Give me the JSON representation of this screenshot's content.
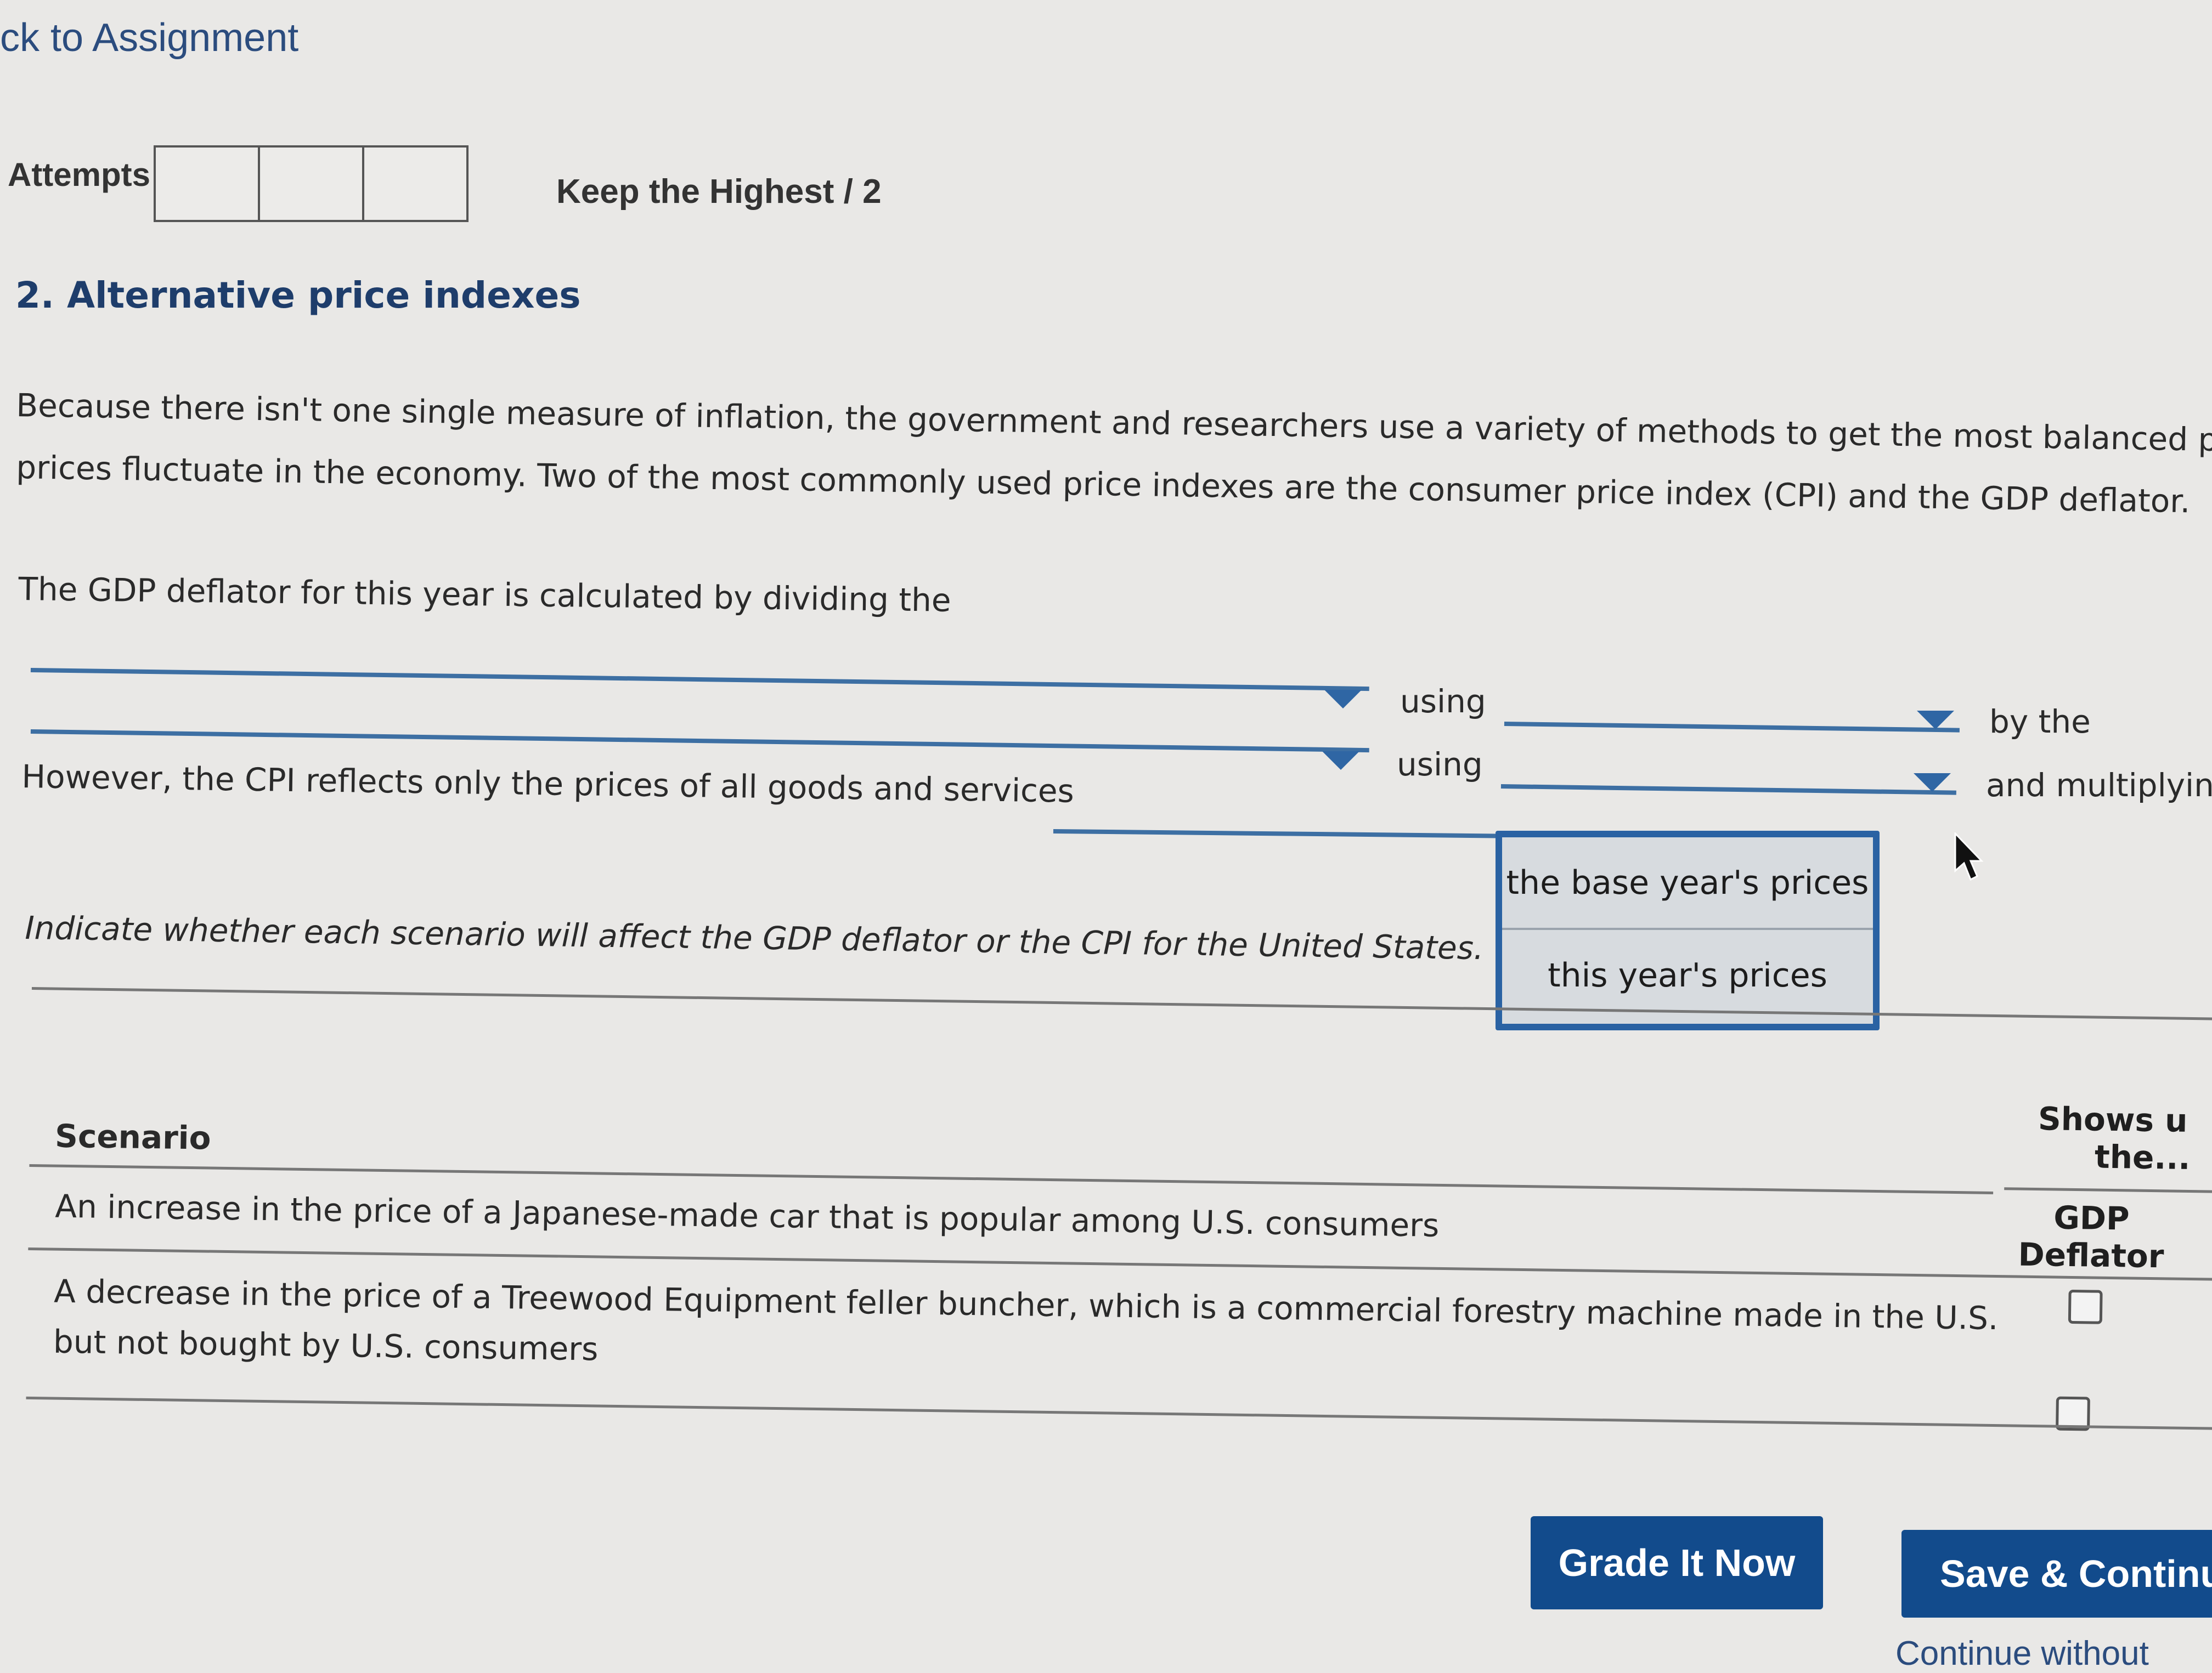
{
  "nav": {
    "back_link": "ck to Assignment"
  },
  "attempts": {
    "label": "Attempts",
    "keep_label": "Keep the Highest / 2"
  },
  "question": {
    "title": "2. Alternative price indexes",
    "intro_line1": "Because there isn't one single measure of inflation, the government and researchers use a variety of methods to get the most balanced pic",
    "intro_line2": "prices fluctuate in the economy. Two of the most commonly used price indexes are the consumer price index (CPI) and the GDP deflator.",
    "gdp_sentence": "The GDP deflator for this year is calculated by dividing the",
    "using_1": "using",
    "by_the": "by the",
    "using_2": "using",
    "and_multiplying": "and multiplying",
    "cpi_sentence": "However, the CPI reflects only the prices of all goods and services",
    "instructions": "Indicate whether each scenario will affect the GDP deflator or the CPI for the United States. Ch"
  },
  "dropdown": {
    "options": [
      "the base year's prices",
      "this year's prices"
    ]
  },
  "table": {
    "scenario_header": "Scenario",
    "shows_header_line1": "Shows u",
    "shows_header_line2": "the...",
    "gdp_header_line1": "GDP",
    "gdp_header_line2": "Deflator",
    "rows": [
      {
        "line1": "An increase in the price of a Japanese-made car that is popular among U.S. consumers",
        "gdp_checked": false
      },
      {
        "line1": "A decrease in the price of a Treewood Equipment feller buncher, which is a commercial forestry machine made in the U.S.",
        "line2": "but not bought by U.S. consumers",
        "gdp_checked": false
      }
    ]
  },
  "buttons": {
    "grade": "Grade It Now",
    "save": "Save & Continue",
    "continue": "Continue without"
  },
  "colors": {
    "accent": "#124b8c",
    "title": "#1e3d6b",
    "dropdown_border": "#2a62a3"
  }
}
